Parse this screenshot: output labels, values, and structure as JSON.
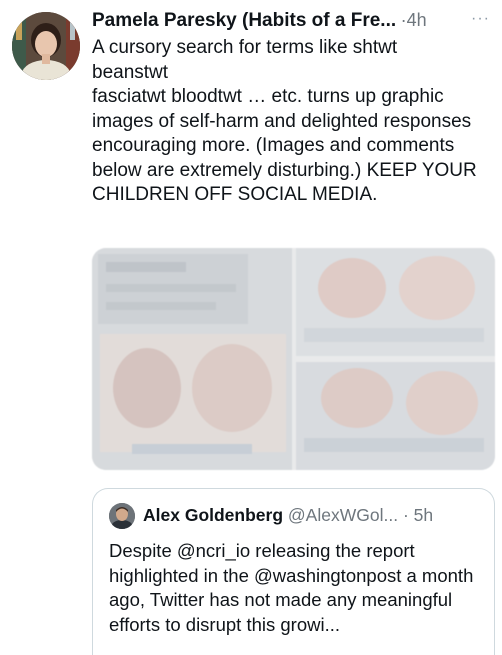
{
  "tweet": {
    "author": "Pamela Paresky (Habits of a Fre...",
    "separator": "·",
    "time": "4h",
    "more": "···",
    "text": "A cursory search for terms like shtwt\nbeanstwt\nfasciatwt bloodtwt … etc. turns up graphic images of self-harm and delighted responses encouraging more. (Images and comments below are extremely disturbing.) KEEP YOUR CHILDREN OFF SOCIAL MEDIA."
  },
  "quote": {
    "author": "Alex Goldenberg",
    "handle": "@AlexWGol...",
    "separator": "·",
    "time": "5h",
    "text": "Despite @ncri_io releasing the report highlighted in the @washingtonpost a month ago, Twitter has not made any meaningful efforts to disrupt this growi..."
  }
}
